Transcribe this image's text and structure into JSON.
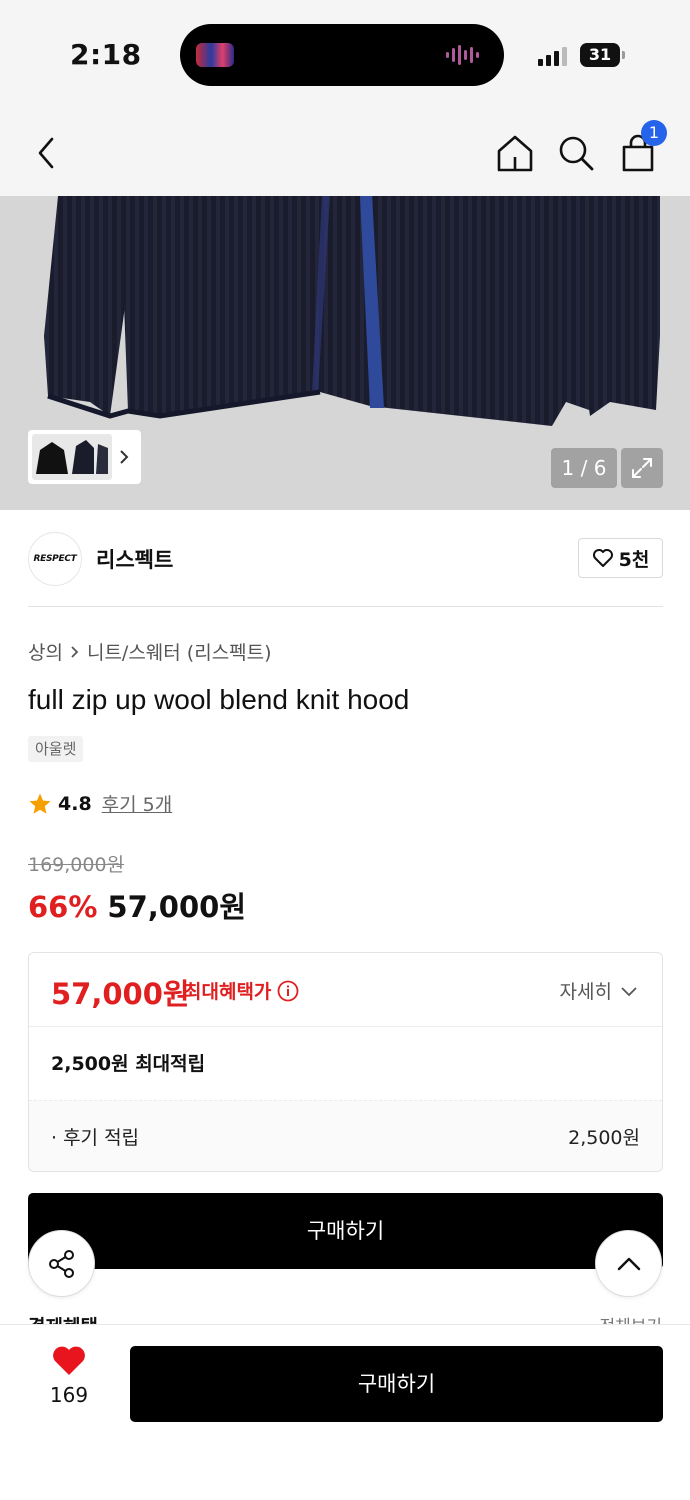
{
  "status": {
    "time": "2:18",
    "battery": "31"
  },
  "nav": {
    "cart_count": "1"
  },
  "gallery": {
    "page": "1 / 6"
  },
  "brand": {
    "logo_text": "RESPECT",
    "name": "리스펙트",
    "likes": "5천"
  },
  "breadcrumb": {
    "category": "상의",
    "subcategory": "니트/스웨터 (리스펙트)"
  },
  "product": {
    "title": "full zip up wool blend knit hood",
    "badge": "아울렛",
    "rating": "4.8",
    "review_link": "후기 5개",
    "original_price": "169,000원",
    "discount": "66%",
    "price": "57,000원"
  },
  "benefit": {
    "max_price": "57,000원",
    "max_label": "최대혜택가",
    "detail": "자세히",
    "points_total": "2,500원 최대적립",
    "review_points_label": "· 후기 적립",
    "review_points_value": "2,500원"
  },
  "buttons": {
    "buy": "구매하기",
    "bottom_buy": "구매하기"
  },
  "peek": {
    "left": "결제혜택",
    "right": "전체보기"
  },
  "wishlist": {
    "count": "169"
  },
  "colors": {
    "accent_red": "#e02020",
    "badge_blue": "#2563eb",
    "primary": "#000000"
  }
}
